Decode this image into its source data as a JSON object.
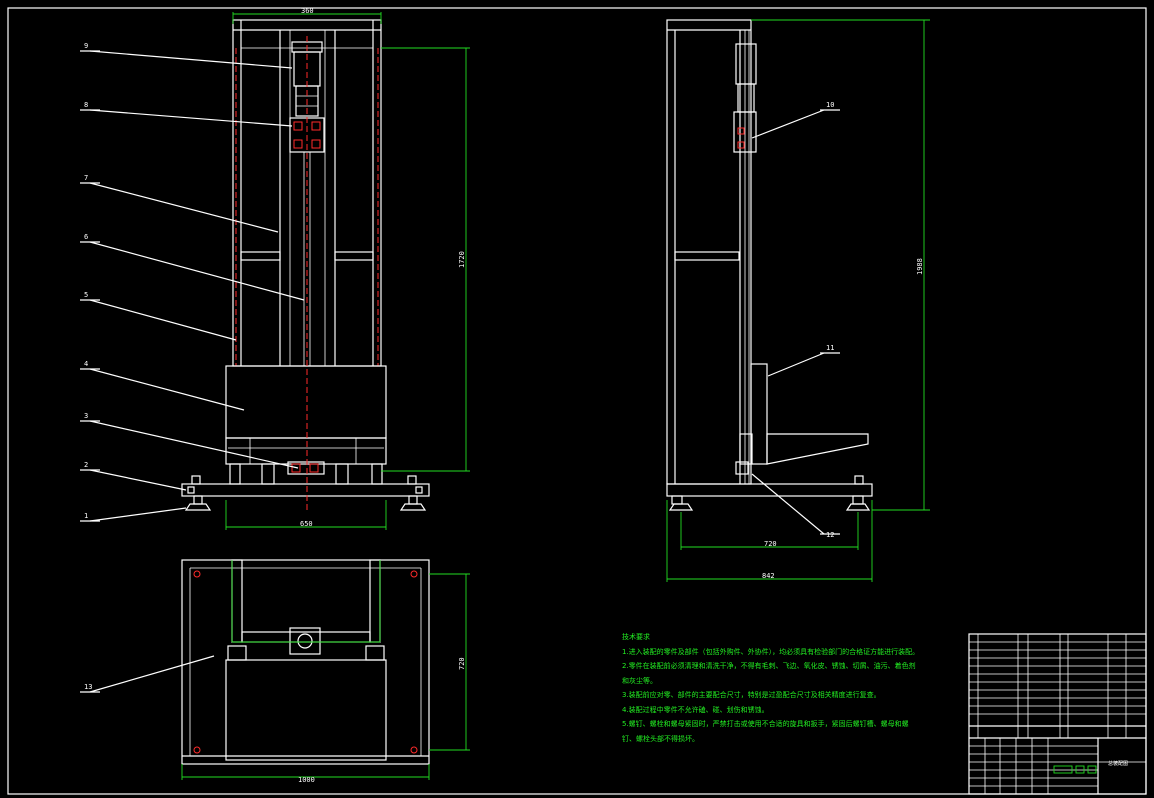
{
  "front_view": {
    "dims": {
      "top_width": "360",
      "height": "1720",
      "base_width": "650"
    },
    "part_labels": [
      "1",
      "2",
      "3",
      "4",
      "5",
      "6",
      "7",
      "8",
      "9"
    ]
  },
  "side_view": {
    "dims": {
      "height": "1988",
      "inner_width": "720",
      "outer_width": "842"
    },
    "part_labels": [
      "10",
      "11",
      "12"
    ]
  },
  "top_view": {
    "dims": {
      "depth": "720",
      "width": "1000"
    },
    "part_labels": [
      "13"
    ]
  },
  "notes": {
    "title": "技术要求",
    "items": [
      "1.进入装配的零件及部件（包括外购件、外协件），均必须具有检验部门的合格证方能进行装配。",
      "2.零件在装配前必须清理和清洗干净，不得有毛刺、飞边、氧化皮、锈蚀、切屑、油污、着色剂和灰尘等。",
      "3.装配前应对零、部件的主要配合尺寸，特别是过盈配合尺寸及相关精度进行复查。",
      "4.装配过程中零件不允许磕、碰、划伤和锈蚀。",
      "5.螺钉、螺栓和螺母紧固时，严禁打击或使用不合适的旋具和扳手，紧固后螺钉槽、螺母和螺钉、螺栓头部不得损坏。"
    ]
  },
  "title_block": {
    "drawing_name": "总装配图"
  },
  "colors": {
    "background": "#000000",
    "outline": "#ffffff",
    "dimension": "#22dd22",
    "centerline": "#ff2a2a"
  }
}
